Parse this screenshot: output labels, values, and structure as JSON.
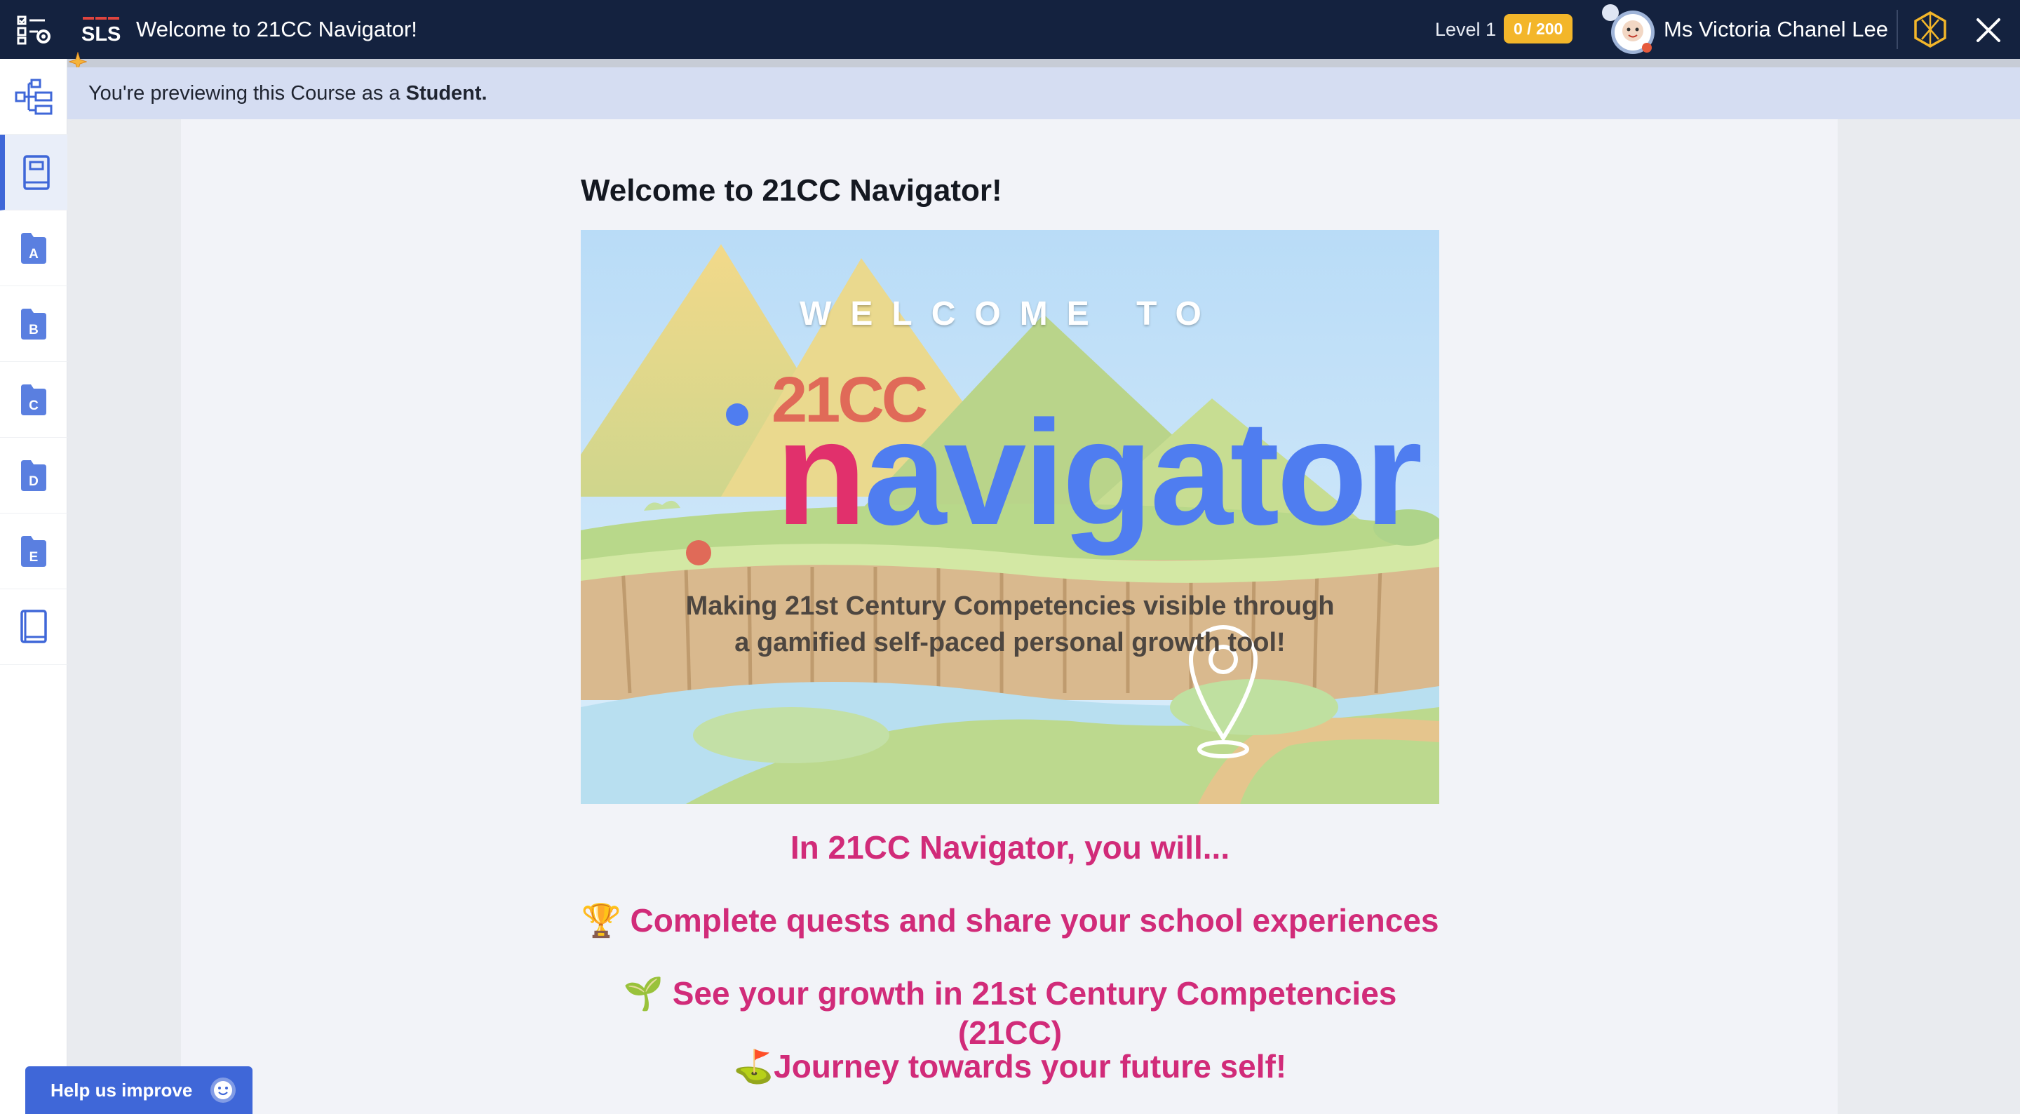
{
  "topbar": {
    "app_logo": "SLS",
    "title": "Welcome to 21CC Navigator!",
    "level": "Level 1",
    "xp": "0 / 200",
    "user_name": "Ms Victoria Chanel Lee"
  },
  "banner": {
    "prefix": "You're previewing this Course as a ",
    "role": "Student."
  },
  "sidebar": {
    "items": [
      {
        "icon": "course-map-icon"
      },
      {
        "icon": "notebook-icon",
        "active": true
      },
      {
        "icon": "folder-icon",
        "letter": "A"
      },
      {
        "icon": "folder-icon",
        "letter": "B"
      },
      {
        "icon": "folder-icon",
        "letter": "C"
      },
      {
        "icon": "folder-icon",
        "letter": "D"
      },
      {
        "icon": "folder-icon",
        "letter": "E"
      },
      {
        "icon": "book-icon"
      }
    ]
  },
  "content": {
    "title": "Welcome to 21CC Navigator!",
    "hero": {
      "welcome": "WELCOME TO",
      "brand_small": "21CC",
      "brand_first_letter": "n",
      "brand_rest": "avigator",
      "tagline_1": "Making 21st Century Competencies visible through",
      "tagline_2": "a gamified self-paced personal growth tool!"
    },
    "lines": [
      {
        "emoji": "",
        "text": "In 21CC Navigator, you will..."
      },
      {
        "emoji": "🏆",
        "text": "Complete quests and share your school experiences"
      },
      {
        "emoji": "🌱",
        "text": "See your growth in 21st Century Competencies (21CC)"
      },
      {
        "emoji": "⛳",
        "text": "Journey towards your future self!"
      }
    ]
  },
  "help": {
    "label": "Help us improve"
  },
  "colors": {
    "topbar": "#14223f",
    "accent": "#3f67d8",
    "xp_badge": "#f3b62a",
    "highlight_text": "#d12b79",
    "banner": "#d5ddf2"
  }
}
